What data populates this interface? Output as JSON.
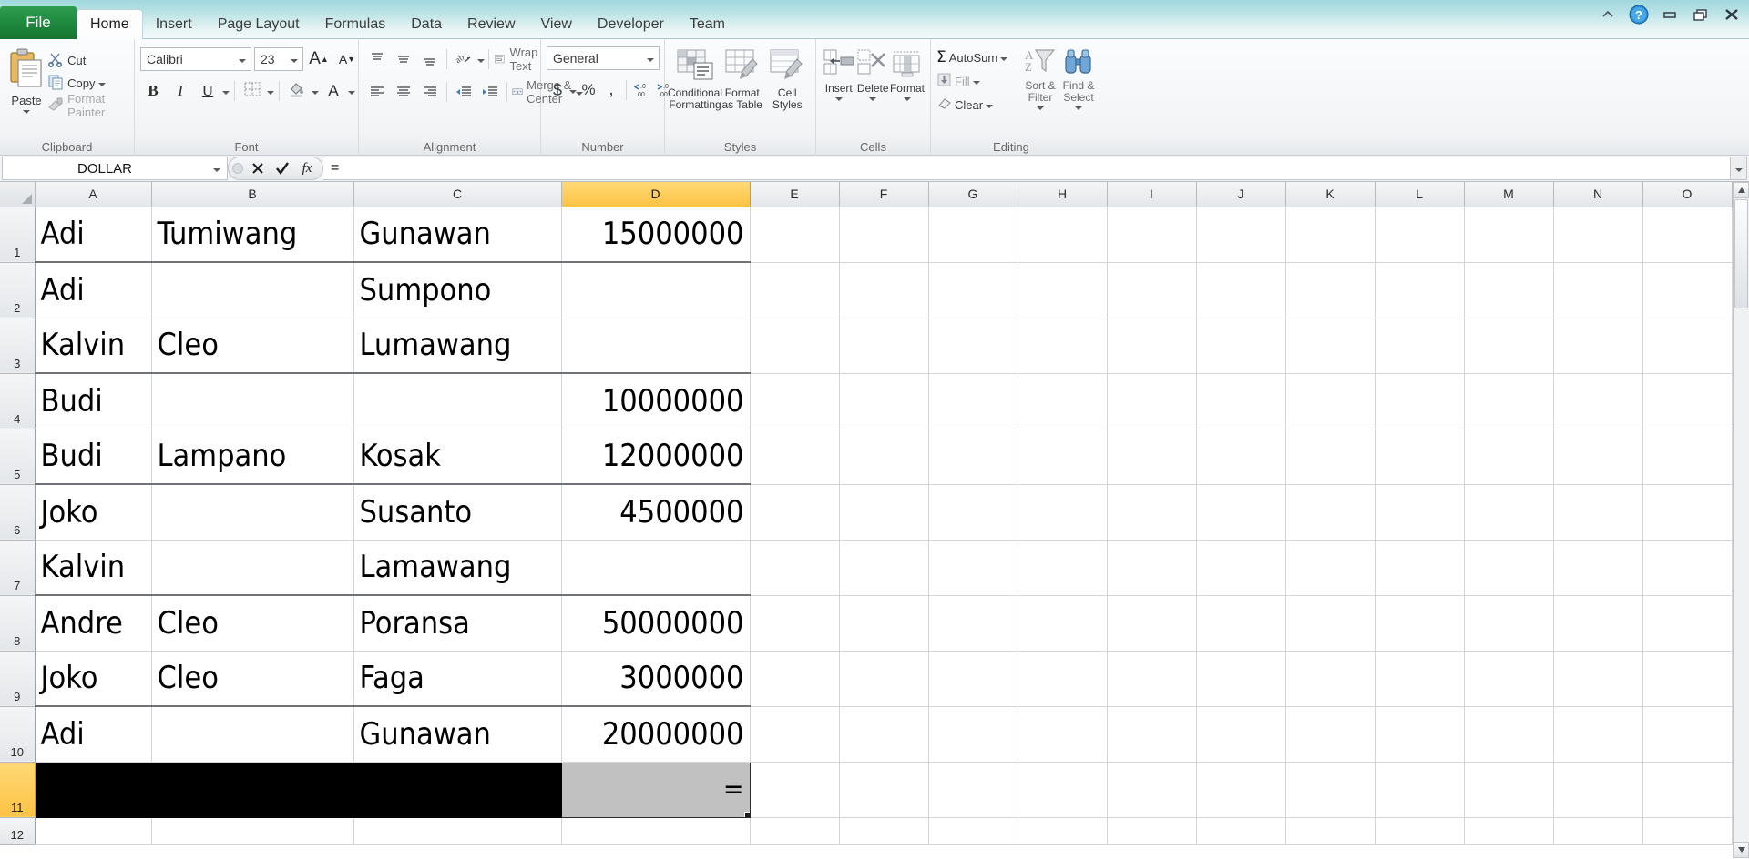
{
  "window": {
    "file_tab": "File",
    "tabs": [
      "Home",
      "Insert",
      "Page Layout",
      "Formulas",
      "Data",
      "Review",
      "View",
      "Developer",
      "Team"
    ],
    "active_tab": "Home",
    "controls": {
      "collapse_ribbon": "collapse-ribbon-icon",
      "help": "help-icon",
      "minimize": "minimize-icon",
      "restore": "restore-icon",
      "close": "close-icon"
    }
  },
  "ribbon": {
    "clipboard": {
      "title": "Clipboard",
      "paste": "Paste",
      "cut": "Cut",
      "copy": "Copy",
      "format_painter": "Format Painter"
    },
    "font": {
      "title": "Font",
      "font_name": "Calibri",
      "font_size": "23",
      "grow_font": "A",
      "shrink_font": "A",
      "bold": "B",
      "italic": "I",
      "underline": "U",
      "borders": "borders-icon",
      "fill_color": "fill-color-icon",
      "font_color": "A"
    },
    "alignment": {
      "title": "Alignment",
      "top_align": "top-align-icon",
      "middle_align": "middle-align-icon",
      "bottom_align": "bottom-align-icon",
      "orientation": "orientation-icon",
      "wrap_text": "Wrap Text",
      "align_left": "align-left-icon",
      "align_center": "align-center-icon",
      "align_right": "align-right-icon",
      "decrease_indent": "decrease-indent-icon",
      "increase_indent": "increase-indent-icon",
      "merge_center": "Merge & Center"
    },
    "number": {
      "title": "Number",
      "format": "General",
      "accounting": "$",
      "percent": "%",
      "comma": ",",
      "increase_decimal": ".00",
      "decrease_decimal": ".00"
    },
    "styles": {
      "title": "Styles",
      "conditional_formatting": "Conditional\nFormatting",
      "conditional_formatting_l1": "Conditional",
      "conditional_formatting_l2": "Formatting",
      "format_as_table_l1": "Format",
      "format_as_table_l2": "as Table",
      "cell_styles_l1": "Cell",
      "cell_styles_l2": "Styles"
    },
    "cells": {
      "title": "Cells",
      "insert": "Insert",
      "delete": "Delete",
      "format": "Format"
    },
    "editing": {
      "title": "Editing",
      "autosum": "AutoSum",
      "fill": "Fill",
      "clear": "Clear",
      "sort_filter_l1": "Sort &",
      "sort_filter_l2": "Filter",
      "find_select_l1": "Find &",
      "find_select_l2": "Select"
    }
  },
  "formula_bar": {
    "name_box": "DOLLAR",
    "cancel": "cancel-icon",
    "enter": "enter-icon",
    "insert_function": "fx",
    "value": "="
  },
  "sheet": {
    "columns": [
      "A",
      "B",
      "C",
      "D",
      "E",
      "F",
      "G",
      "H",
      "I",
      "J",
      "K",
      "L",
      "M",
      "N",
      "O"
    ],
    "active_column": "D",
    "active_row": "11",
    "active_cell_value": "=",
    "rows": [
      {
        "n": "1",
        "cells": [
          "Adi",
          "Tumiwang",
          "Gunawan",
          "15000000"
        ]
      },
      {
        "n": "2",
        "cells": [
          "Adi",
          "",
          "Sumpono",
          ""
        ]
      },
      {
        "n": "3",
        "cells": [
          "Kalvin",
          "Cleo",
          "Lumawang",
          ""
        ]
      },
      {
        "n": "4",
        "cells": [
          "Budi",
          "",
          "",
          "10000000"
        ]
      },
      {
        "n": "5",
        "cells": [
          "Budi",
          "Lampano",
          "Kosak",
          "12000000"
        ]
      },
      {
        "n": "6",
        "cells": [
          "Joko",
          "",
          "Susanto",
          "4500000"
        ]
      },
      {
        "n": "7",
        "cells": [
          "Kalvin",
          "",
          "Lamawang",
          ""
        ]
      },
      {
        "n": "8",
        "cells": [
          "Andre",
          "Cleo",
          "Poransa",
          "50000000"
        ]
      },
      {
        "n": "9",
        "cells": [
          "Joko",
          "Cleo",
          "Faga",
          "3000000"
        ]
      },
      {
        "n": "10",
        "cells": [
          "Adi",
          "",
          "Gunawan",
          "20000000"
        ]
      },
      {
        "n": "11",
        "cells": [
          "",
          "",
          "",
          "="
        ]
      },
      {
        "n": "12",
        "cells": [
          "",
          "",
          "",
          ""
        ]
      }
    ]
  },
  "colors": {
    "accent": "#fcc344",
    "file_tab_green": "#1f8a3f",
    "title_bar": "#bde3e6",
    "black_fill": "#000000",
    "active_cell_fill": "#c1c1c1"
  }
}
